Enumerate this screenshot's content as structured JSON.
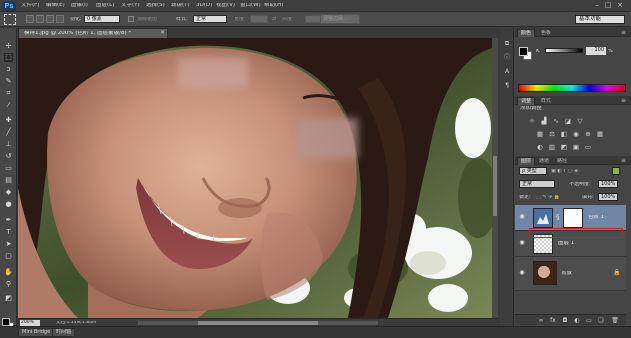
{
  "app": {
    "logo": "Ps"
  },
  "menu": [
    "文件(F)",
    "编辑(E)",
    "图像(I)",
    "图层(L)",
    "文字(Y)",
    "选择(S)",
    "滤镜(T)",
    "3D(D)",
    "视图(V)",
    "窗口(W)",
    "帮助(H)"
  ],
  "window_controls": [
    "–",
    "□",
    "×"
  ],
  "options_bar": {
    "feather_label": "羽化:",
    "feather_value": "0 像素",
    "antialias_label": "消除锯齿",
    "style_label": "样式:",
    "style_value": "正常",
    "width_label": "宽度:",
    "height_label": "高度:",
    "refine_edge": "调整边缘...",
    "workspace": "基本功能"
  },
  "document": {
    "tab_label": "模特1.jpg @ 200% (色阶 1, 图层蒙版/8) *",
    "close": "×",
    "zoom": "200%",
    "doc_size": "文档:1.34M/1.84M"
  },
  "bottom_tabs": [
    "Mini Bridge",
    "时间轴"
  ],
  "panels": {
    "color": {
      "tabs": [
        "颜色",
        "色板"
      ],
      "channel_label": "K",
      "value": "100",
      "unit": "%"
    },
    "adjustments": {
      "tabs": [
        "调整",
        "样式"
      ],
      "title": "添加调整"
    },
    "layers": {
      "tabs": [
        "图层",
        "通道",
        "路径"
      ],
      "filter_kind": "ρ 类型",
      "blend_mode": "正常",
      "opacity_label": "不透明度:",
      "opacity_value": "100%",
      "lock_label": "锁定:",
      "fill_label": "填充:",
      "fill_value": "100%",
      "items": [
        {
          "name": "色阶 1",
          "selected": true
        },
        {
          "name": "图层 1",
          "selected": false
        },
        {
          "name": "背景",
          "selected": false
        }
      ]
    }
  },
  "colors": {
    "red_highlight": "#e0161b",
    "selected_layer": "#6f86a6",
    "ps_blue": "#6fb7f2"
  }
}
